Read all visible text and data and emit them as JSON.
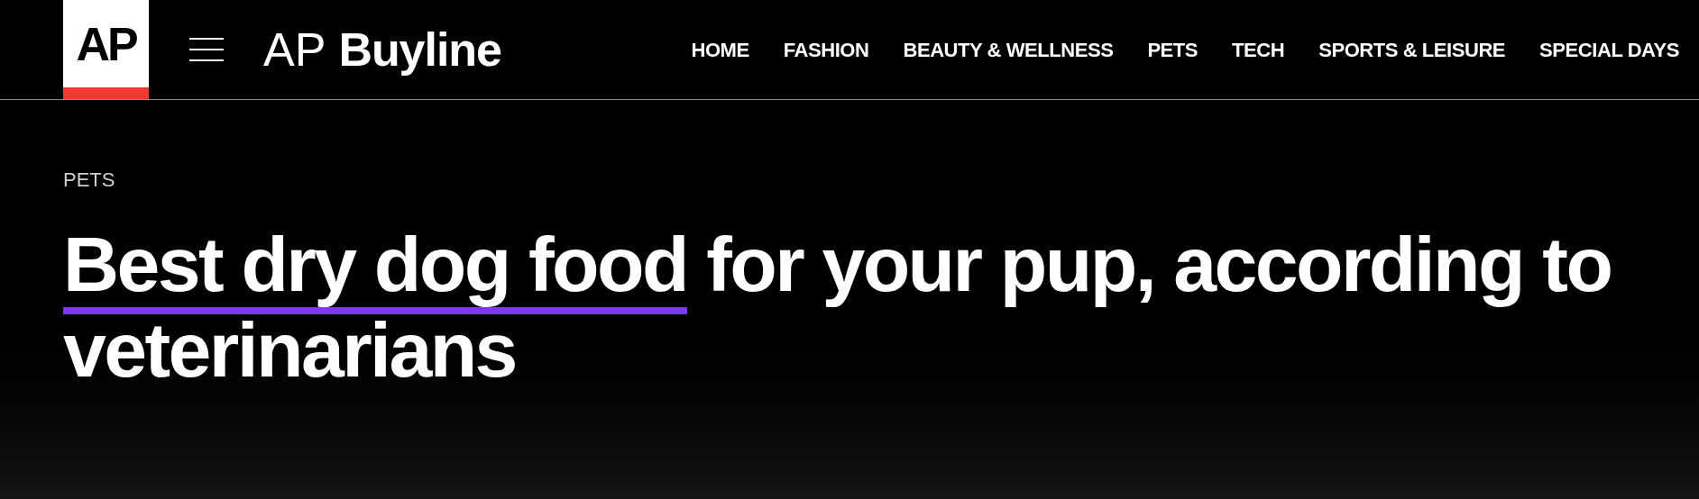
{
  "header": {
    "logo": "AP",
    "brand_light": "AP",
    "brand_bold": "Buyline",
    "nav": [
      {
        "label": "HOME"
      },
      {
        "label": "FASHION"
      },
      {
        "label": "BEAUTY & WELLNESS"
      },
      {
        "label": "PETS"
      },
      {
        "label": "TECH"
      },
      {
        "label": "SPORTS & LEISURE"
      },
      {
        "label": "SPECIAL DAYS"
      }
    ]
  },
  "article": {
    "category": "PETS",
    "headline_link": "Best dry dog food",
    "headline_rest": " for your pup, according to veterinarians"
  }
}
